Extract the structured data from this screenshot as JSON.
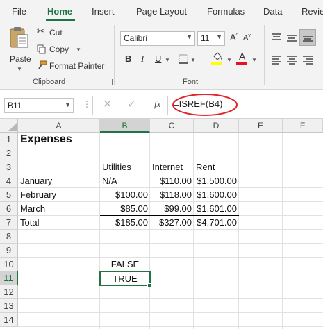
{
  "ribbon_tabs": [
    "File",
    "Home",
    "Insert",
    "Page Layout",
    "Formulas",
    "Data",
    "Revie"
  ],
  "clipboard": {
    "paste": "Paste",
    "cut": "Cut",
    "copy": "Copy",
    "format_painter": "Format Painter",
    "group_label": "Clipboard"
  },
  "font": {
    "name": "Calibri",
    "size": "11",
    "grow": "A",
    "shrink": "A",
    "bold": "B",
    "italic": "I",
    "underline": "U",
    "font_color_letter": "A",
    "group_label": "Font",
    "highlight_color": "#ffff00",
    "font_color": "#e81123"
  },
  "formula_bar": {
    "name_box": "B11",
    "fx": "fx",
    "formula": "=ISREF(B4)",
    "annotation_color": "#e0242a"
  },
  "grid": {
    "columns": [
      "A",
      "B",
      "C",
      "D",
      "E",
      "F"
    ],
    "rows": [
      "1",
      "2",
      "3",
      "4",
      "5",
      "6",
      "7",
      "8",
      "9",
      "10",
      "11",
      "12",
      "13",
      "14"
    ],
    "selected_cell": "B11",
    "cells": {
      "A1": "Expenses",
      "B3": "Utilities",
      "C3": "Internet",
      "D3": "Rent",
      "A4": "January",
      "B4": "N/A",
      "C4": "$110.00",
      "D4": "$1,500.00",
      "A5": "February",
      "B5": "$100.00",
      "C5": "$118.00",
      "D5": "$1,600.00",
      "A6": "March",
      "B6": "$85.00",
      "C6": "$99.00",
      "D6": "$1,601.00",
      "A7": "Total",
      "B7": "$185.00",
      "C7": "$327.00",
      "D7": "$4,701.00",
      "B10": "FALSE",
      "B11": "TRUE"
    },
    "accent_color": "#217346"
  }
}
